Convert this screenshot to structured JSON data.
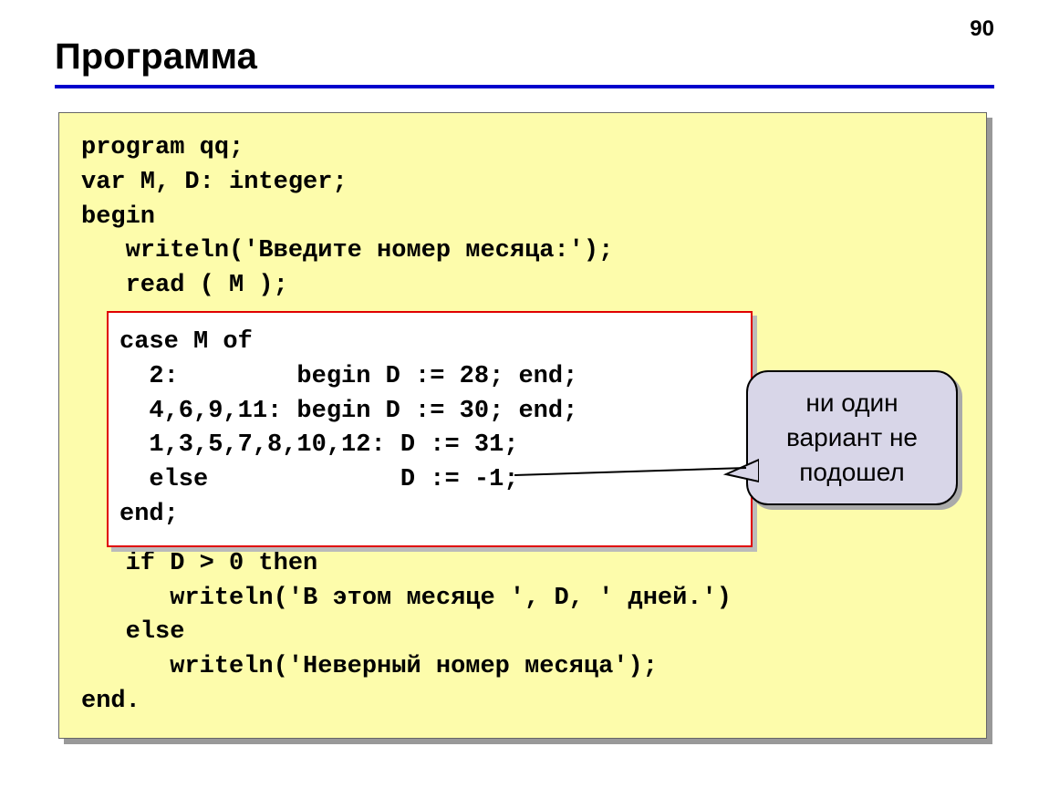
{
  "page_number": "90",
  "title": "Программа",
  "code": {
    "line1": "program qq;",
    "line2": "var M, D: integer;",
    "line3": "begin",
    "line4": "   writeln('Введите номер месяца:');",
    "line5": "   read ( M );",
    "inner1": "case M of",
    "inner2": "  2:        begin D := 28; end;",
    "inner3": "  4,6,9,11: begin D := 30; end;",
    "inner4": "  1,3,5,7,8,10,12: D := 31;",
    "inner5": "  else             D := -1;",
    "inner6": "end;",
    "line6": "   if D > 0 then",
    "line7": "      writeln('В этом месяце ', D, ' дней.')",
    "line8": "   else",
    "line9": "      writeln('Неверный номер месяца');",
    "line10": "end."
  },
  "callout": "ни один вариант не подошел"
}
